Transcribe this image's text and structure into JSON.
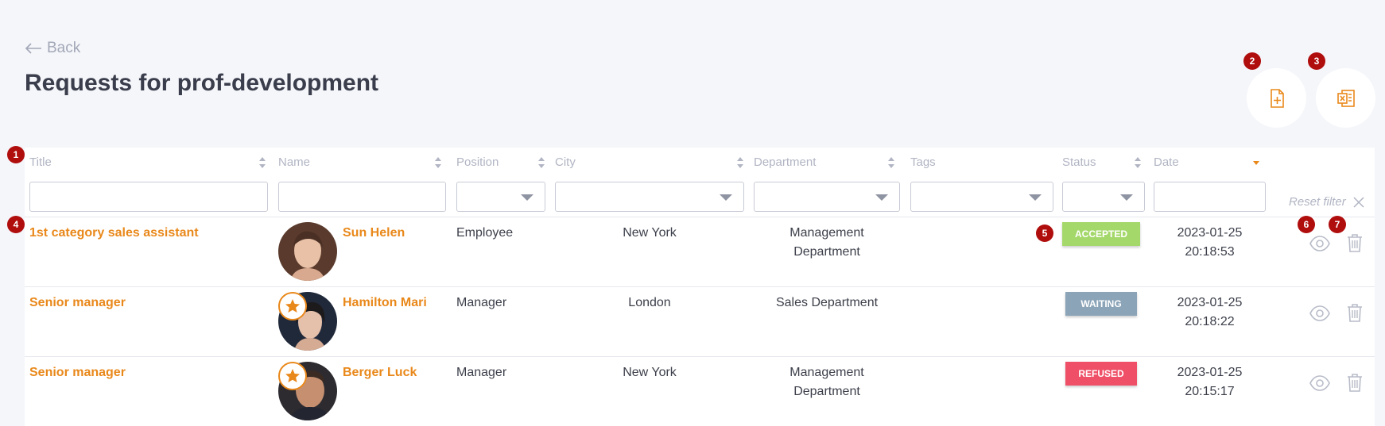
{
  "header": {
    "back_label": "Back",
    "title": "Requests for prof-development"
  },
  "markers": [
    "1",
    "2",
    "3",
    "4",
    "5",
    "6",
    "7"
  ],
  "columns": {
    "title": "Title",
    "name": "Name",
    "position": "Position",
    "city": "City",
    "department": "Department",
    "tags": "Tags",
    "status": "Status",
    "date": "Date"
  },
  "filters": {
    "reset_label": "Reset filter"
  },
  "rows": [
    {
      "title": "1st category sales assistant",
      "name": "Sun Helen",
      "position": "Employee",
      "city": "New York",
      "department_line1": "Management",
      "department_line2": "Department",
      "status": "ACCEPTED",
      "date": "2023-01-25",
      "time": "20:18:53",
      "starred": false
    },
    {
      "title": "Senior manager",
      "name": "Hamilton Mari",
      "position": "Manager",
      "city": "London",
      "department_line1": "Sales Department",
      "department_line2": "",
      "status": "WAITING",
      "date": "2023-01-25",
      "time": "20:18:22",
      "starred": true
    },
    {
      "title": "Senior manager",
      "name": "Berger Luck",
      "position": "Manager",
      "city": "New York",
      "department_line1": "Management",
      "department_line2": "Department",
      "status": "REFUSED",
      "date": "2023-01-25",
      "time": "20:15:17",
      "starred": true
    }
  ],
  "colors": {
    "accent": "#e9881a",
    "accepted": "#a5d86b",
    "waiting": "#8ba4b8",
    "refused": "#ef4f67",
    "marker": "#b00d0d"
  }
}
